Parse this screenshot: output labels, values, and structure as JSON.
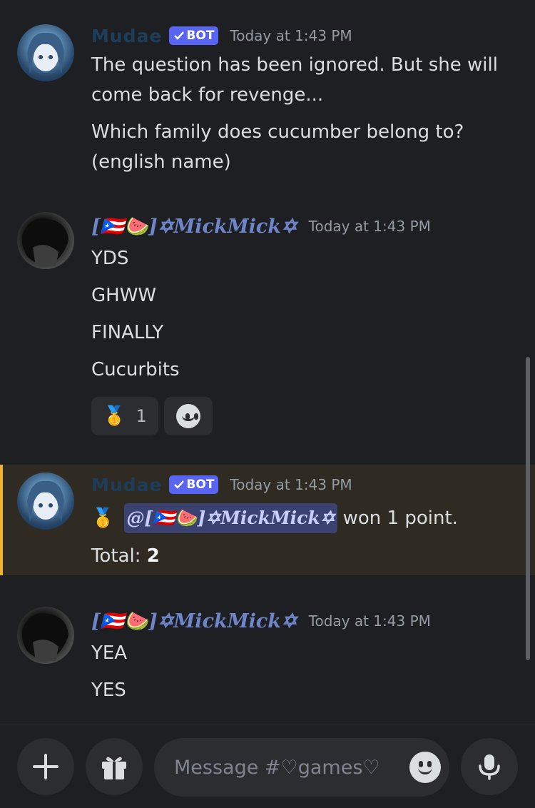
{
  "messages": [
    {
      "author": "Mudae",
      "bot_tag": "BOT",
      "time": "Today at 1:43 PM",
      "lines": [
        "The question has been ignored. But she will",
        "come back for revenge...",
        "Which family does cucumber belong to?",
        "(english name)"
      ]
    },
    {
      "author_prefix": "[🇵🇷🍉]",
      "author": "✡MickMick✡",
      "time": "Today at 1:43 PM",
      "lines": [
        "YDS",
        "GHWW",
        "FINALLY",
        "Cucurbits"
      ],
      "reactions": [
        {
          "emoji": "🥇",
          "count": "1"
        }
      ]
    },
    {
      "author": "Mudae",
      "bot_tag": "BOT",
      "time": "Today at 1:43 PM",
      "medal": "🥇",
      "mention": "@[🇵🇷🍉]✡MickMick✡",
      "won_text": "won 1 point.",
      "total_label": "Total:",
      "total_value": "2"
    },
    {
      "author_prefix": "[🇵🇷🍉]",
      "author": "✡MickMick✡",
      "time": "Today at 1:43 PM",
      "lines": [
        "YEA",
        "YES"
      ]
    }
  ],
  "composer": {
    "placeholder": "Message #♡games♡",
    "add_icon": "plus-icon",
    "gift_icon": "gift-icon",
    "emoji_icon": "emoji-icon",
    "mic_icon": "microphone-icon"
  },
  "colors": {
    "background": "#1e1f22",
    "bot_badge": "#5865f2",
    "highlight_border": "#f0b232",
    "mick_name": "#6e86c9"
  }
}
